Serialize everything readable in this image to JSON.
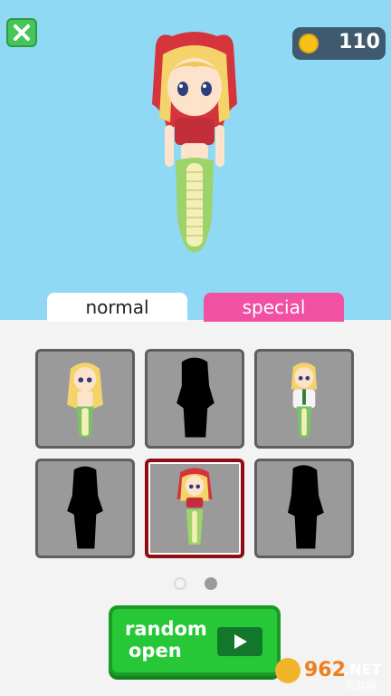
{
  "currency": {
    "coins": "110"
  },
  "tabs": [
    {
      "label": "normal",
      "active": true
    },
    {
      "label": "special",
      "active": false
    }
  ],
  "grid": {
    "cells": [
      {
        "state": "unlocked",
        "character": "mermaid-blonde"
      },
      {
        "state": "locked"
      },
      {
        "state": "unlocked",
        "character": "mermaid-white-coat"
      },
      {
        "state": "locked"
      },
      {
        "state": "selected",
        "character": "mermaid-red-hood"
      },
      {
        "state": "locked"
      }
    ]
  },
  "pagination": {
    "current": 2,
    "total": 2
  },
  "random_button": {
    "line1": "random",
    "line2": "open"
  },
  "watermark": {
    "brand": "962.NET",
    "sub": "乐游网"
  },
  "colors": {
    "sky": "#8fd9f4",
    "special_tab": "#f250a2",
    "button_green": "#27c837",
    "selected_border": "#8f0e12",
    "close_green": "#46c55a"
  }
}
